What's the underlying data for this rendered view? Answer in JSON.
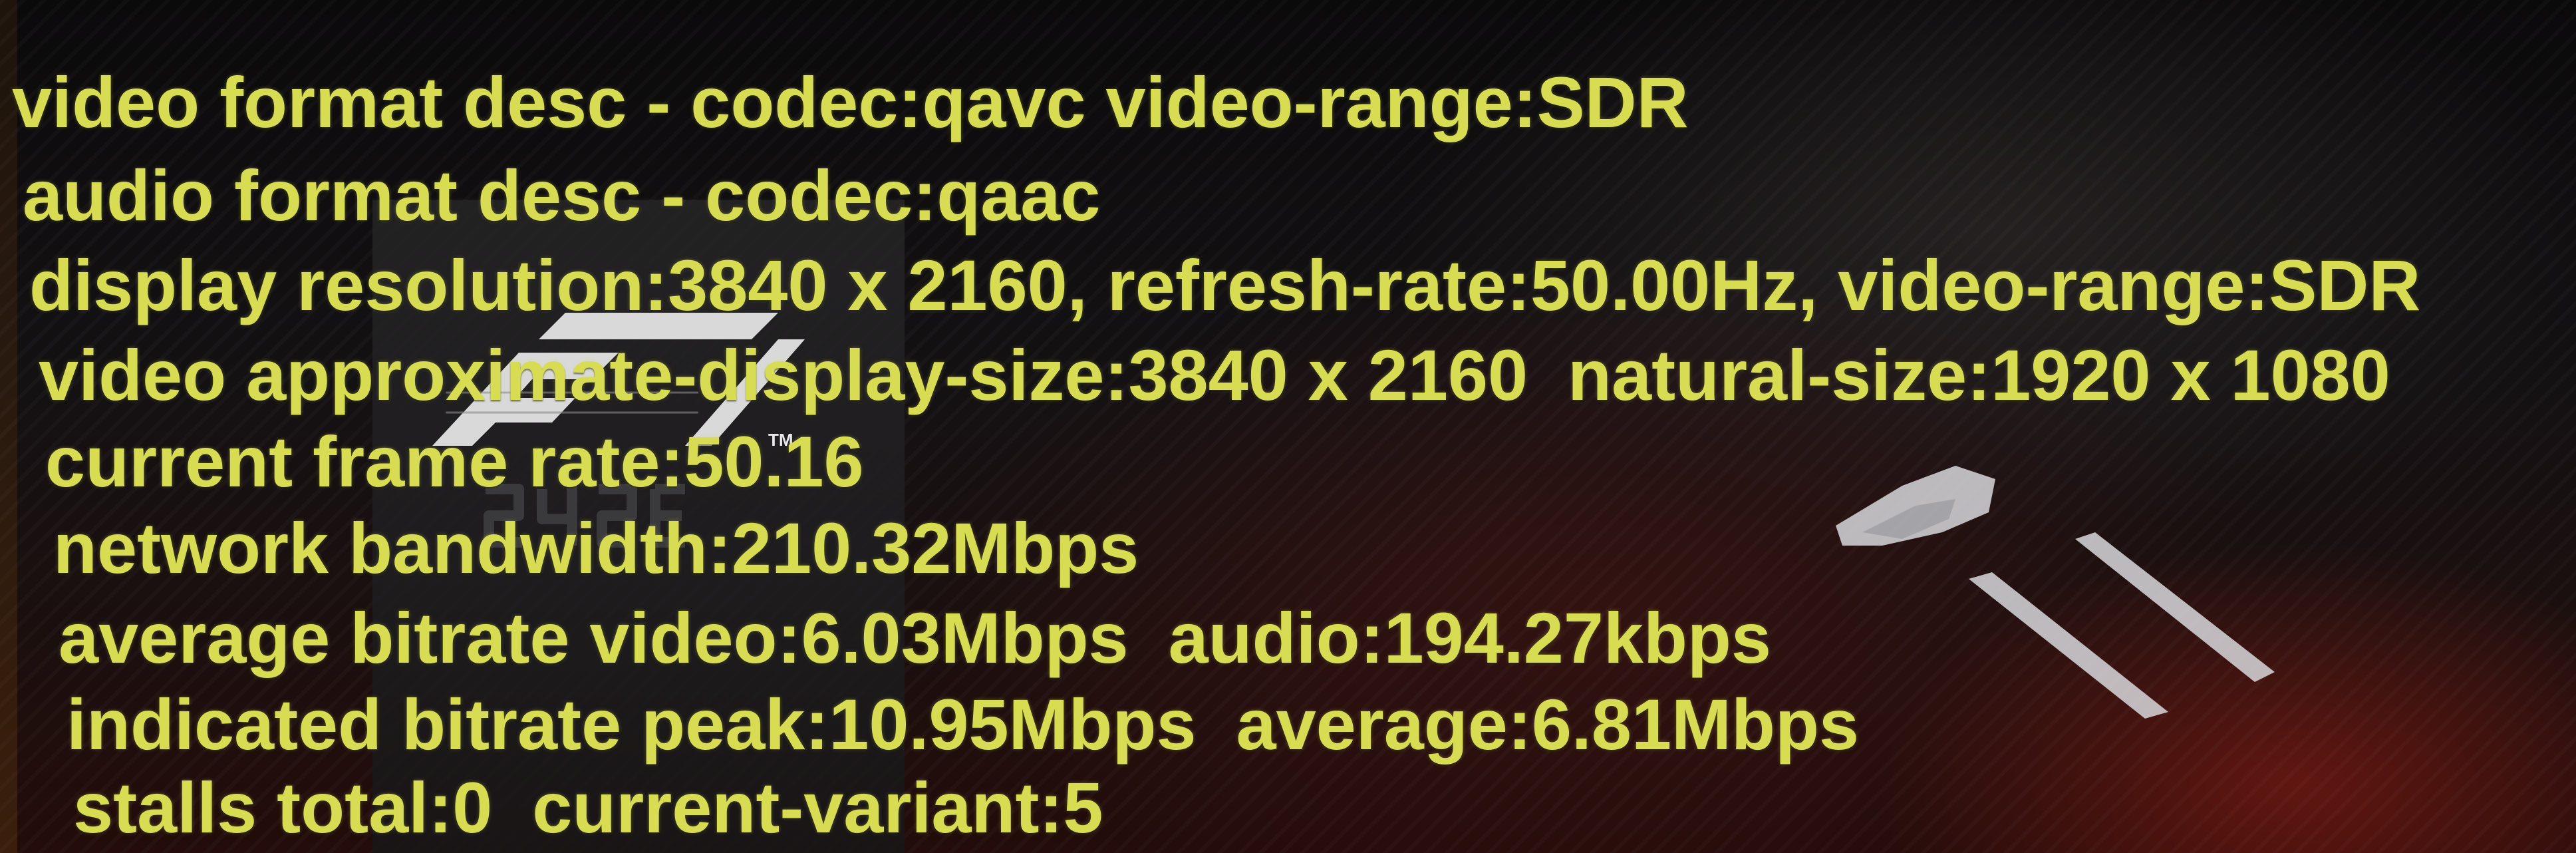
{
  "overlay": {
    "text_color": "#d7dc52",
    "lines": [
      "video format desc - codec:qavc video-range:SDR",
      "audio format desc - codec:qaac",
      "display resolution:3840 x 2160, refresh-rate:50.00Hz, video-range:SDR",
      "video approximate-display-size:3840 x 2160  natural-size:1920 x 1080",
      "current frame rate:50.16",
      "network bandwidth:210.32Mbps",
      "average bitrate video:6.03Mbps  audio:194.27kbps",
      "indicated bitrate peak:10.95Mbps  average:6.81Mbps",
      "stalls total:0  current-variant:5"
    ]
  },
  "background": {
    "logo_icon": "f1-logo-icon",
    "logo_trademark": "TM",
    "graphic_icon": "race-car-graphic-icon"
  }
}
